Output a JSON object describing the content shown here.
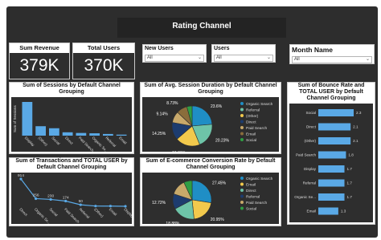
{
  "page_title": "Rating Channel",
  "cards": {
    "revenue": {
      "label": "Sum Revenue",
      "value": "379K"
    },
    "users": {
      "label": "Total Users",
      "value": "370K"
    }
  },
  "slicers": {
    "new_users": {
      "label": "New Users",
      "value": "All"
    },
    "users": {
      "label": "Users",
      "value": "All"
    },
    "month": {
      "label": "Month Name",
      "value": "All"
    }
  },
  "colors": {
    "bar": "#5aa9e6",
    "dark_panel": "#2e2e2e",
    "frame": "#2d2d2d"
  },
  "chart_data": [
    {
      "id": "sessions",
      "type": "bar",
      "title": "Sum of Sessions by Default Channel Grouping",
      "ylabel": "Sum of Sessions",
      "categories": [
        "Display",
        "(Other)",
        "Social",
        "Direct",
        "Paid Search",
        "Organic Se...",
        "Referral",
        "Email"
      ],
      "values": [
        100,
        28,
        22,
        10,
        8,
        7,
        5,
        3
      ]
    },
    {
      "id": "session_duration",
      "type": "pie",
      "title": "Sum of Avg. Session Duration by Default Channel Grouping",
      "labels": [
        "Organic Search",
        "Referral",
        "(Other)",
        "Direct",
        "Paid Search",
        "Email",
        "Social"
      ],
      "colors": [
        "#1f8ec5",
        "#6ec4a8",
        "#f2c94c",
        "#1d3c6e",
        "#c8a96a",
        "#8a6d3b",
        "#2f9e44"
      ],
      "values": [
        23.6,
        20.23,
        19.81,
        14.25,
        9.14,
        8.73,
        4.24
      ],
      "data_labels": [
        "23.6%",
        "20.23%",
        "19.81%",
        "14.25%",
        "9.14%",
        "8.73%"
      ]
    },
    {
      "id": "bounce_rate",
      "type": "bar",
      "title": "Sum of Bounce Rate and TOTAL USER by Default Channel Grouping",
      "categories": [
        "Social",
        "Direct",
        "(Other)",
        "Paid Search",
        "Display",
        "Referral",
        "Organic Se...",
        "Email"
      ],
      "values": [
        2.3,
        2.1,
        2.1,
        1.8,
        1.7,
        1.7,
        1.7,
        1.3
      ],
      "value_labels": [
        "2.3",
        "2.1",
        "2.1",
        "1.8",
        "1.7",
        "1.7",
        "1.7",
        "1.3"
      ]
    },
    {
      "id": "transactions",
      "type": "line",
      "title": "Sum of Transactions and TOTAL USER by Default Channel Grouping",
      "categories": [
        "Direct",
        "Organic Se...",
        "Social",
        "Paid Search",
        "Referral",
        "(Other)",
        "Email",
        "Display"
      ],
      "values": [
        914,
        256,
        230,
        174,
        50,
        9,
        6,
        0
      ],
      "value_labels": [
        "914",
        "256",
        "230",
        "174",
        "50",
        "",
        "",
        ""
      ]
    },
    {
      "id": "conversion_rate",
      "type": "pie",
      "title": "Sum of E-commerce Conversion Rate by Default Channel Grouping",
      "labels": [
        "Organic Search",
        "Email",
        "Direct",
        "Referral",
        "Paid Search",
        "Social"
      ],
      "colors": [
        "#1f8ec5",
        "#f2c94c",
        "#6ec4a8",
        "#1d3c6e",
        "#c8a96a",
        "#2f9e44"
      ],
      "values": [
        27.45,
        20.95,
        18.88,
        12.72,
        13.0,
        7.0
      ],
      "data_labels": [
        "27.45%",
        "20.95%",
        "18.88%",
        "12.72%"
      ]
    }
  ]
}
